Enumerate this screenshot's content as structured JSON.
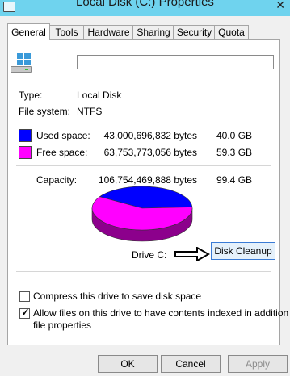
{
  "window": {
    "title": "Local Disk (C:) Properties"
  },
  "tabs": [
    {
      "label": "General",
      "active": true
    },
    {
      "label": "Tools"
    },
    {
      "label": "Hardware"
    },
    {
      "label": "Sharing"
    },
    {
      "label": "Security"
    },
    {
      "label": "Quota"
    }
  ],
  "drive": {
    "name_value": "",
    "type_label": "Type:",
    "type_value": "Local Disk",
    "fs_label": "File system:",
    "fs_value": "NTFS"
  },
  "usage": {
    "used": {
      "label": "Used space:",
      "bytes": "43,000,696,832 bytes",
      "size": "40.0 GB",
      "color": "#0000ff"
    },
    "free": {
      "label": "Free space:",
      "bytes": "63,753,773,056 bytes",
      "size": "59.3 GB",
      "color": "#ff00ff"
    },
    "capacity": {
      "label": "Capacity:",
      "bytes": "106,754,469,888 bytes",
      "size": "99.4 GB"
    },
    "drive_label": "Drive C:"
  },
  "chart_data": {
    "type": "pie",
    "series": [
      {
        "value": 40.0,
        "color": "#0000ff"
      },
      {
        "value": 59.3,
        "color": "#ff00ff"
      }
    ]
  },
  "buttons": {
    "disk_cleanup": "Disk Cleanup",
    "ok": "OK",
    "cancel": "Cancel",
    "apply": "Apply"
  },
  "options": {
    "compress_label": "Compress this drive to save disk space",
    "compress_checked": false,
    "index_label_line1": "Allow files on this drive to have contents indexed in addition to",
    "index_label_line2": "file properties",
    "index_checked": true
  }
}
